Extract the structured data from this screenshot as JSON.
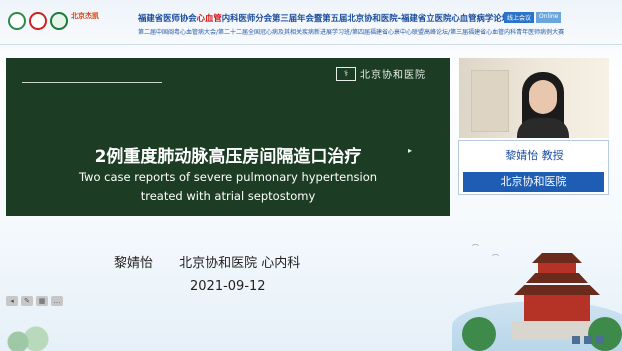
{
  "header": {
    "title_line1_prefix": "福建省医师协会",
    "title_line1_highlight": "心血管",
    "title_line1_suffix": "内科医师分会第三届年会暨第五届北京协和医院-福建省立医院心血管病学论坛",
    "title_line2": "第二届中国闽粤心血管病大会/第二十二届全国冠心病及其相关疾病新进展学习班/第四届福建省心衰中心联盟高峰论坛/第三届福建省心血管内科青年医师病例大赛",
    "live_label": "线上会议",
    "online_label": "Online",
    "brand_small": "北京杰凯"
  },
  "slide": {
    "hospital_logo_text": "北京协和医院",
    "title_cn": "2例重度肺动脉高压房间隔造口治疗",
    "title_en_line1": "Two case reports of severe pulmonary hypertension",
    "title_en_line2": "treated with atrial septostomy"
  },
  "presenter": {
    "name": "黎婧怡",
    "affiliation": "北京协和医院 心内科",
    "date": "2021-09-12"
  },
  "speaker_card": {
    "name_title": "黎婧怡  教授",
    "hospital": "北京协和医院"
  }
}
